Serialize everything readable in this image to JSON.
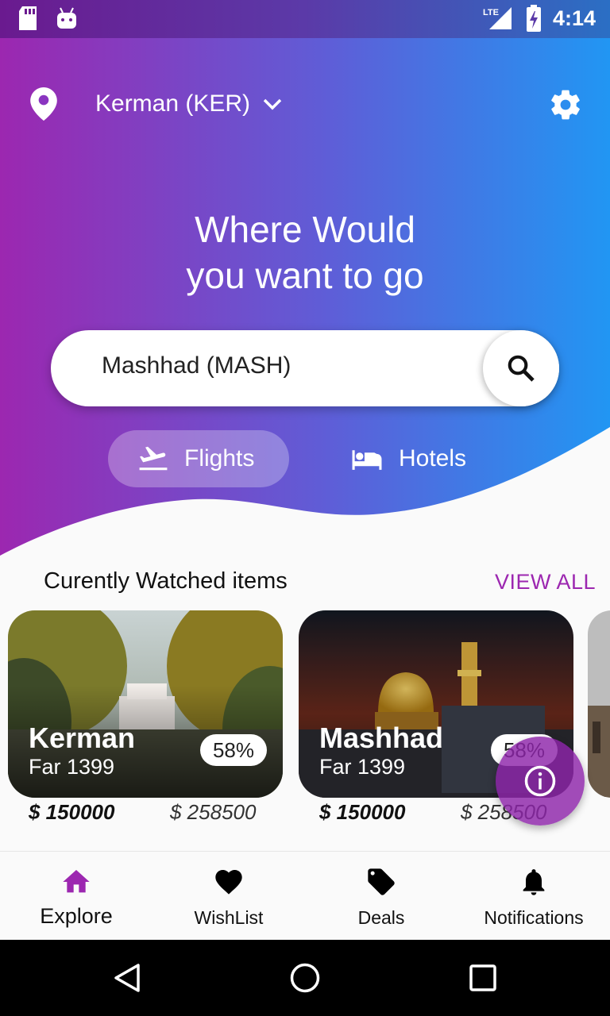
{
  "status_bar": {
    "time": "4:14",
    "network": "LTE"
  },
  "header": {
    "location": "Kerman (KER)",
    "headline_line1": "Where Would",
    "headline_line2": "you want to go"
  },
  "search": {
    "value": "Mashhad (MASH)"
  },
  "tabs": [
    {
      "label": "Flights",
      "icon": "flight-takeoff-icon",
      "selected": true
    },
    {
      "label": "Hotels",
      "icon": "bed-icon",
      "selected": false
    }
  ],
  "watched": {
    "title": "Curently Watched items",
    "view_all": "VIEW ALL",
    "cards": [
      {
        "city": "Kerman",
        "date": "Far 1399",
        "discount": "58%",
        "price": "$ 150000",
        "old_price": "$ 258500"
      },
      {
        "city": "Mashhad",
        "date": "Far 1399",
        "discount": "58%",
        "price": "$ 150000",
        "old_price": "$ 258500"
      }
    ]
  },
  "bottom_nav": [
    {
      "label": "Explore",
      "icon": "home-icon",
      "active": true
    },
    {
      "label": "WishList",
      "icon": "heart-icon",
      "active": false
    },
    {
      "label": "Deals",
      "icon": "tag-icon",
      "active": false
    },
    {
      "label": "Notifications",
      "icon": "bell-icon",
      "active": false
    }
  ],
  "colors": {
    "gradient_start": "#9c27b0",
    "gradient_end": "#2196f3",
    "accent": "#9c27b0",
    "fab": "#8e24aa"
  }
}
